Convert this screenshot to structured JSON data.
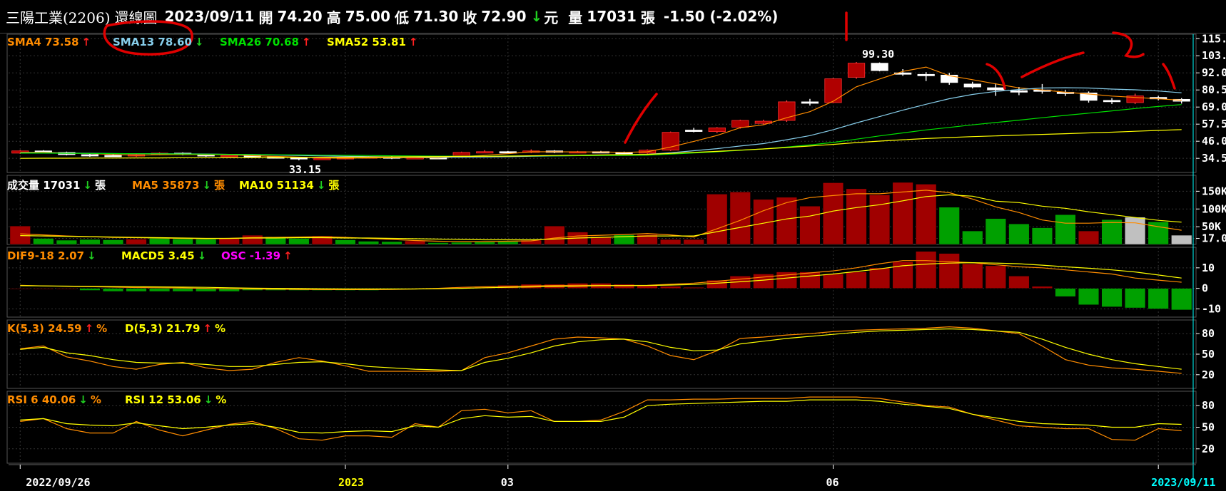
{
  "header": {
    "stock": "三陽工業(2206)",
    "view": "還線圖",
    "date": "2023/09/11",
    "open_label": "開",
    "open": "74.20",
    "high_label": "高",
    "high": "75.00",
    "low_label": "低",
    "low": "71.30",
    "close_label": "收",
    "close": "72.90",
    "unit": "元",
    "vol_label": "量",
    "vol": "17031",
    "vol_unit": "張",
    "change": "-1.50 (-2.02%)"
  },
  "colors": {
    "up": "#b00000",
    "down": "#00a000",
    "sma4": "#ff8c00",
    "sma13": "#87ceeb",
    "sma26": "#00e000",
    "sma52": "#ffff00",
    "k": "#ff8c00",
    "d": "#ffff00",
    "axis": "#ffffff",
    "grid": "#333333",
    "cursor": "#00ffff",
    "annotation": "#e00000"
  },
  "legends": {
    "price": [
      {
        "text": "SMA4 73.58",
        "color": "#ff8c00",
        "arrow": "↑"
      },
      {
        "text": "SMA13 78.60",
        "color": "#87ceeb",
        "arrow": "↓"
      },
      {
        "text": "SMA26 70.68",
        "color": "#00e000",
        "arrow": "↑"
      },
      {
        "text": "SMA52 53.81",
        "color": "#ffff00",
        "arrow": "↑"
      }
    ],
    "volume": [
      {
        "text": "成交量 17031",
        "color": "#ffffff",
        "arrow": "↓",
        "suffix": "張",
        "suffix_color": "#ffffff"
      },
      {
        "text": "MA5 35873",
        "color": "#ff8c00",
        "arrow": "↓",
        "suffix": "張",
        "suffix_color": "#ff8c00"
      },
      {
        "text": "MA10 51134",
        "color": "#ffff00",
        "arrow": "↓",
        "suffix": "張",
        "suffix_color": "#ffff00"
      }
    ],
    "macd": [
      {
        "text": "DIF9-18 2.07",
        "color": "#ff8c00",
        "arrow": "↓"
      },
      {
        "text": "MACD5 3.45",
        "color": "#ffff00",
        "arrow": "↓"
      },
      {
        "text": "OSC -1.39",
        "color": "#ff00ff",
        "arrow": "↑"
      }
    ],
    "kd": [
      {
        "text": "K(5,3) 24.59",
        "color": "#ff8c00",
        "arrow": "↑",
        "suffix": "%",
        "suffix_color": "#ff8c00"
      },
      {
        "text": "D(5,3) 21.79",
        "color": "#ffff00",
        "arrow": "↑",
        "suffix": "%",
        "suffix_color": "#ffff00"
      }
    ],
    "rsi": [
      {
        "text": "RSI 6 40.06",
        "color": "#ff8c00",
        "arrow": "↓",
        "suffix": "%",
        "suffix_color": "#ff8c00"
      },
      {
        "text": "RSI 12 53.06",
        "color": "#ffff00",
        "arrow": "↓",
        "suffix": "%",
        "suffix_color": "#ffff00"
      }
    ]
  },
  "chart_data": {
    "type": "candlestick",
    "x_labels": [
      {
        "text": "2022/09/26",
        "i": 0,
        "color": "#ffffff"
      },
      {
        "text": "2023",
        "i": 14,
        "color": "#ffff00"
      },
      {
        "text": "03",
        "i": 21,
        "color": "#ffffff"
      },
      {
        "text": "06",
        "i": 35,
        "color": "#ffffff"
      },
      {
        "text": "2023/09/11",
        "i": 49,
        "color": "#00ffff"
      }
    ],
    "annotations": {
      "high": "99.30",
      "low": "33.15"
    },
    "price": {
      "ylim": [
        25,
        118
      ],
      "ticks": [
        115.0,
        103.5,
        92.0,
        80.5,
        69.0,
        57.5,
        46.0,
        34.5
      ],
      "tick_labels": [
        "115.0",
        "103.5",
        "92.0",
        "80.5",
        "69.0",
        "57.5",
        "46.0",
        "34.5"
      ],
      "ohlc": [
        [
          38.0,
          40.0,
          37.5,
          39.5
        ],
        [
          39.5,
          40.0,
          38.0,
          38.5
        ],
        [
          38.5,
          39.0,
          36.5,
          37.0
        ],
        [
          37.0,
          37.5,
          35.5,
          36.5
        ],
        [
          36.5,
          37.5,
          35.5,
          36.0
        ],
        [
          36.0,
          37.5,
          35.5,
          37.0
        ],
        [
          37.0,
          38.5,
          36.5,
          38.0
        ],
        [
          38.0,
          38.5,
          36.5,
          37.0
        ],
        [
          37.0,
          37.5,
          35.5,
          36.0
        ],
        [
          36.0,
          37.0,
          35.5,
          36.5
        ],
        [
          36.5,
          37.0,
          35.0,
          35.5
        ],
        [
          35.5,
          36.0,
          34.5,
          35.0
        ],
        [
          35.0,
          35.5,
          33.15,
          34.0
        ],
        [
          34.0,
          35.0,
          33.5,
          34.5
        ],
        [
          34.5,
          35.5,
          34.0,
          35.0
        ],
        [
          35.0,
          36.0,
          34.5,
          35.5
        ],
        [
          35.5,
          36.0,
          34.0,
          34.5
        ],
        [
          34.5,
          35.5,
          34.0,
          35.0
        ],
        [
          35.0,
          35.5,
          34.0,
          34.5
        ],
        [
          35.5,
          39.0,
          35.0,
          38.5
        ],
        [
          38.5,
          40.0,
          38.0,
          39.0
        ],
        [
          39.0,
          39.5,
          38.0,
          38.5
        ],
        [
          38.5,
          40.5,
          38.0,
          39.5
        ],
        [
          39.5,
          40.0,
          38.0,
          38.5
        ],
        [
          38.5,
          39.5,
          38.0,
          39.0
        ],
        [
          39.0,
          39.5,
          38.0,
          38.5
        ],
        [
          38.5,
          39.0,
          37.5,
          38.0
        ],
        [
          38.0,
          40.5,
          37.5,
          40.0
        ],
        [
          40.0,
          52.5,
          39.5,
          52.0
        ],
        [
          53.5,
          55.0,
          52.0,
          53.5
        ],
        [
          52.5,
          55.5,
          51.5,
          55.0
        ],
        [
          55.5,
          60.5,
          54.5,
          60.0
        ],
        [
          58.0,
          60.5,
          57.0,
          59.5
        ],
        [
          60.0,
          73.5,
          59.0,
          72.5
        ],
        [
          72.5,
          74.5,
          70.0,
          71.5
        ],
        [
          72.0,
          88.5,
          71.5,
          88.0
        ],
        [
          89.0,
          99.3,
          88.0,
          98.5
        ],
        [
          98.5,
          99.0,
          93.0,
          93.5
        ],
        [
          92.0,
          94.5,
          90.0,
          91.5
        ],
        [
          91.0,
          92.5,
          86.5,
          90.0
        ],
        [
          90.5,
          92.0,
          84.0,
          85.5
        ],
        [
          84.5,
          86.0,
          81.5,
          82.5
        ],
        [
          82.0,
          85.0,
          76.5,
          80.5
        ],
        [
          80.0,
          82.5,
          77.0,
          79.0
        ],
        [
          80.5,
          84.5,
          78.0,
          80.0
        ],
        [
          79.0,
          80.5,
          76.5,
          78.5
        ],
        [
          78.5,
          79.5,
          72.0,
          73.5
        ],
        [
          73.5,
          75.0,
          71.0,
          73.5
        ],
        [
          72.0,
          78.0,
          71.0,
          76.5
        ],
        [
          75.5,
          76.5,
          73.5,
          74.5
        ],
        [
          74.2,
          75.0,
          71.3,
          72.9
        ]
      ],
      "sma4": [
        38.5,
        38.6,
        38.0,
        37.8,
        37.1,
        36.6,
        36.9,
        37.1,
        37.0,
        36.9,
        36.3,
        35.8,
        35.3,
        34.8,
        34.6,
        34.8,
        34.9,
        35.0,
        34.8,
        35.7,
        36.6,
        37.6,
        38.9,
        38.9,
        38.8,
        38.8,
        38.5,
        38.9,
        42.1,
        45.9,
        49.9,
        55.1,
        57.0,
        61.8,
        65.9,
        72.9,
        82.6,
        87.9,
        93.0,
        95.9,
        90.1,
        87.4,
        84.6,
        81.9,
        80.5,
        79.0,
        77.8,
        76.4,
        75.5,
        74.5,
        73.6
      ],
      "sma13": [
        38.2,
        38.2,
        38.0,
        37.9,
        37.7,
        37.6,
        37.6,
        37.5,
        37.4,
        37.2,
        37.0,
        36.7,
        36.4,
        36.1,
        35.9,
        35.7,
        35.5,
        35.4,
        35.2,
        35.3,
        35.4,
        35.6,
        35.9,
        36.1,
        36.3,
        36.5,
        36.8,
        37.2,
        38.3,
        39.6,
        41.0,
        42.8,
        44.4,
        47.0,
        49.8,
        53.7,
        58.3,
        62.6,
        66.9,
        70.9,
        74.6,
        77.5,
        79.5,
        80.8,
        81.8,
        82.0,
        81.8,
        81.1,
        80.6,
        79.8,
        78.6
      ],
      "sma26": [
        38.0,
        38.0,
        37.9,
        37.8,
        37.7,
        37.6,
        37.5,
        37.4,
        37.3,
        37.2,
        37.1,
        36.9,
        36.8,
        36.6,
        36.5,
        36.4,
        36.2,
        36.1,
        36.0,
        36.0,
        36.0,
        36.1,
        36.1,
        36.2,
        36.3,
        36.4,
        36.5,
        36.6,
        37.3,
        38.1,
        38.9,
        39.9,
        40.8,
        42.1,
        43.5,
        45.2,
        47.4,
        49.6,
        51.6,
        53.6,
        55.3,
        57.0,
        58.6,
        60.2,
        61.8,
        63.4,
        64.9,
        66.4,
        68.0,
        69.4,
        70.7
      ],
      "sma52": [
        34.5,
        34.6,
        34.6,
        34.7,
        34.7,
        34.8,
        34.8,
        34.9,
        34.9,
        35.0,
        35.0,
        35.1,
        35.1,
        35.2,
        35.3,
        35.4,
        35.5,
        35.6,
        35.7,
        35.8,
        35.9,
        36.0,
        36.2,
        36.4,
        36.6,
        36.8,
        37.0,
        37.2,
        37.8,
        38.5,
        39.2,
        40.0,
        40.8,
        41.8,
        42.8,
        43.9,
        45.1,
        46.1,
        47.0,
        47.8,
        48.5,
        49.1,
        49.6,
        50.1,
        50.6,
        51.1,
        51.6,
        52.1,
        52.7,
        53.3,
        53.8
      ]
    },
    "volume": {
      "ylim": [
        0,
        195000
      ],
      "ticks": [
        150000,
        100000,
        50000,
        17031
      ],
      "tick_labels": [
        "150K",
        "100K",
        "50K",
        "17.0K"
      ],
      "values": [
        52000,
        17000,
        12000,
        14000,
        13000,
        15000,
        18000,
        16000,
        15000,
        17000,
        26000,
        22000,
        17000,
        24000,
        13000,
        9000,
        8000,
        10000,
        5000,
        6000,
        7000,
        8000,
        12000,
        52000,
        35000,
        22000,
        27000,
        28000,
        14000,
        14000,
        142000,
        148000,
        127000,
        133000,
        108000,
        174000,
        157000,
        140000,
        175000,
        170000,
        105000,
        38000,
        73000,
        58000,
        47000,
        84000,
        38000,
        70000,
        77000,
        64000,
        26000,
        22000,
        17031
      ],
      "dir": [
        1,
        -1,
        -1,
        -1,
        -1,
        1,
        -1,
        -1,
        -1,
        1,
        1,
        -1,
        -1,
        1,
        -1,
        -1,
        -1,
        1,
        -1,
        -1,
        -1,
        -1,
        1,
        1,
        1,
        1,
        -1,
        1,
        1,
        1,
        1,
        1,
        1,
        1,
        1,
        1,
        1,
        1,
        1,
        1,
        -1,
        -1,
        -1,
        -1,
        -1,
        -1,
        1,
        -1,
        0,
        -1,
        0,
        1,
        -1
      ],
      "ma5": [
        30000,
        27000,
        24000,
        22000,
        20000,
        19000,
        18000,
        17000,
        16000,
        17000,
        19000,
        20000,
        21000,
        22000,
        20000,
        17000,
        14000,
        11000,
        9000,
        8000,
        8000,
        9000,
        10000,
        18000,
        24000,
        26000,
        28000,
        31000,
        27000,
        21000,
        44000,
        68000,
        95000,
        118000,
        132000,
        138000,
        143000,
        143000,
        148000,
        153000,
        146000,
        128000,
        106000,
        90000,
        69000,
        60000,
        60000,
        62000,
        61000,
        50000,
        40000,
        30000,
        35873
      ],
      "ma10": [
        25000,
        24000,
        23000,
        22000,
        21000,
        20000,
        19000,
        18000,
        17000,
        17000,
        18000,
        18000,
        19000,
        19000,
        18000,
        18000,
        17000,
        16000,
        15000,
        14000,
        13000,
        13000,
        13000,
        15000,
        18000,
        20000,
        22000,
        24000,
        24000,
        24000,
        36000,
        48000,
        60000,
        72000,
        80000,
        94000,
        104000,
        112000,
        123000,
        135000,
        140000,
        136000,
        122000,
        118000,
        108000,
        102000,
        92000,
        84000,
        76000,
        68000,
        63000,
        56000,
        51134
      ]
    },
    "macd": {
      "ylim": [
        -14,
        20
      ],
      "ticks": [
        10,
        0,
        -10
      ],
      "tick_labels": [
        "10",
        "0",
        "-10"
      ],
      "osc": [
        0,
        0,
        0,
        -1,
        -1.5,
        -1.5,
        -1.5,
        -1.5,
        -1.5,
        -1.5,
        -1,
        -1,
        -1,
        -1,
        -1,
        -1,
        -0.5,
        0,
        0,
        0.5,
        1,
        1.5,
        2,
        2,
        2.5,
        2.5,
        2,
        1.5,
        1,
        0.5,
        4,
        6,
        7,
        8,
        8,
        7,
        8,
        10,
        13,
        18,
        17,
        12,
        11,
        6,
        1,
        -4,
        -8,
        -9,
        -9.5,
        -10,
        -10.5,
        -11.5,
        -10,
        -9,
        -8,
        -7
      ],
      "dif": [
        1.5,
        1.2,
        1,
        0.8,
        0.6,
        0.4,
        0.3,
        0.2,
        0,
        -0.2,
        -0.3,
        -0.4,
        -0.5,
        -0.6,
        -0.6,
        -0.6,
        -0.5,
        -0.3,
        0,
        0.5,
        0.8,
        1,
        1.2,
        1.4,
        1.5,
        1.5,
        1.4,
        1.5,
        2,
        2.5,
        3.5,
        4.5,
        5.5,
        6.5,
        7.5,
        8.5,
        10,
        12,
        13.5,
        13.5,
        13,
        12.5,
        11.5,
        10.5,
        10,
        9,
        8,
        7,
        5,
        4,
        3,
        2.07
      ],
      "macd5": [
        1.3,
        1.2,
        1.1,
        1,
        0.9,
        0.8,
        0.7,
        0.6,
        0.5,
        0.3,
        0.1,
        0,
        -0.1,
        -0.2,
        -0.3,
        -0.3,
        -0.3,
        -0.3,
        -0.2,
        0,
        0.3,
        0.5,
        0.7,
        0.9,
        1.1,
        1.3,
        1.3,
        1.4,
        1.6,
        1.9,
        2.5,
        3.2,
        4,
        5,
        6,
        7,
        8.2,
        9.5,
        11,
        11.8,
        12.3,
        12.5,
        12.3,
        12,
        11.3,
        10.5,
        9.8,
        9,
        8,
        6.5,
        5,
        3.45
      ]
    },
    "kd": {
      "ylim": [
        0,
        100
      ],
      "ticks": [
        80,
        50,
        20
      ],
      "tick_labels": [
        "80",
        "50",
        "20"
      ],
      "k": [
        58,
        62,
        46,
        40,
        32,
        28,
        35,
        38,
        30,
        26,
        28,
        38,
        45,
        40,
        33,
        25,
        25,
        25,
        25,
        26,
        45,
        52,
        62,
        72,
        75,
        74,
        72,
        62,
        48,
        42,
        55,
        73,
        75,
        78,
        80,
        83,
        85,
        86,
        87,
        88,
        90,
        88,
        84,
        80,
        62,
        42,
        34,
        30,
        28,
        25,
        22,
        18,
        24.59
      ],
      "d": [
        57,
        60,
        52,
        48,
        42,
        38,
        37,
        37,
        35,
        32,
        32,
        35,
        38,
        39,
        36,
        32,
        30,
        28,
        27,
        26,
        38,
        44,
        52,
        62,
        68,
        71,
        72,
        68,
        60,
        55,
        56,
        65,
        69,
        73,
        76,
        79,
        82,
        84,
        85,
        86,
        87,
        86,
        84,
        82,
        72,
        60,
        50,
        42,
        36,
        32,
        28,
        24,
        21.79
      ]
    },
    "rsi": {
      "ylim": [
        0,
        100
      ],
      "ticks": [
        80,
        50,
        20
      ],
      "tick_labels": [
        "80",
        "50",
        "20"
      ],
      "rsi6": [
        58,
        62,
        48,
        42,
        42,
        58,
        46,
        38,
        46,
        54,
        58,
        48,
        34,
        32,
        38,
        38,
        36,
        55,
        50,
        73,
        75,
        70,
        73,
        58,
        58,
        60,
        72,
        88,
        88,
        89,
        89,
        90,
        90,
        90,
        92,
        92,
        92,
        90,
        85,
        80,
        78,
        68,
        60,
        52,
        50,
        48,
        48,
        33,
        32,
        48,
        45,
        40.06
      ],
      "rsi12": [
        60,
        62,
        55,
        53,
        52,
        56,
        52,
        48,
        50,
        53,
        55,
        50,
        43,
        42,
        44,
        45,
        44,
        52,
        50,
        62,
        66,
        64,
        65,
        58,
        58,
        58,
        64,
        80,
        82,
        83,
        84,
        85,
        86,
        86,
        88,
        88,
        88,
        86,
        82,
        79,
        76,
        68,
        63,
        58,
        55,
        54,
        53,
        50,
        50,
        55,
        54,
        53.06
      ]
    }
  }
}
